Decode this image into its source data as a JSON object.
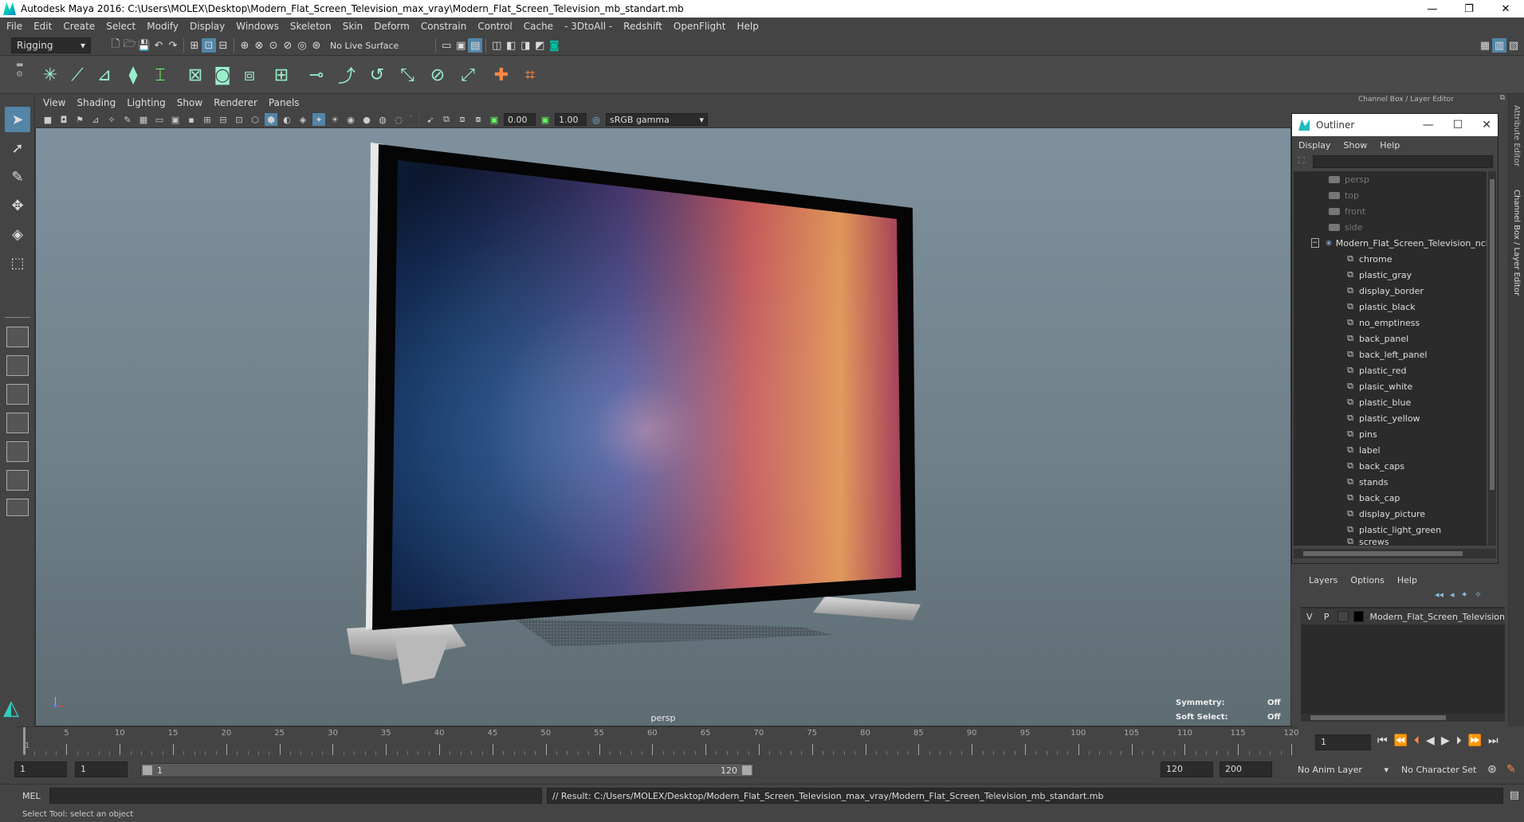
{
  "window": {
    "title": "Autodesk Maya 2016: C:\\Users\\MOLEX\\Desktop\\Modern_Flat_Screen_Television_max_vray\\Modern_Flat_Screen_Television_mb_standart.mb",
    "minimize": "—",
    "restore": "❐",
    "close": "✕"
  },
  "menubar": [
    "File",
    "Edit",
    "Create",
    "Select",
    "Modify",
    "Display",
    "Windows",
    "Skeleton",
    "Skin",
    "Deform",
    "Constrain",
    "Control",
    "Cache",
    "- 3DtoAll -",
    "Redshift",
    "OpenFlight",
    "Help"
  ],
  "statusline": {
    "menuset": "Rigging",
    "live_surface": "No Live Surface"
  },
  "viewport": {
    "menu": [
      "View",
      "Shading",
      "Lighting",
      "Show",
      "Renderer",
      "Panels"
    ],
    "exposure": "0.00",
    "gamma": "1.00",
    "color_space": "sRGB gamma",
    "camera": "persp",
    "symmetry_label": "Symmetry:",
    "symmetry_value": "Off",
    "soft_select_label": "Soft Select:",
    "soft_select_value": "Off"
  },
  "channel_box": {
    "header": "Channel Box / Layer Editor",
    "side_tab_1": "Attribute Editor",
    "side_tab_2": "Channel Box / Layer Editor"
  },
  "outliner": {
    "title": "Outliner",
    "menu": [
      "Display",
      "Show",
      "Help"
    ],
    "cameras": [
      "persp",
      "top",
      "front",
      "side"
    ],
    "root": "Modern_Flat_Screen_Television_ncl",
    "children": [
      "chrome",
      "plastic_gray",
      "display_border",
      "plastic_black",
      "no_emptiness",
      "back_panel",
      "back_left_panel",
      "plastic_red",
      "plasic_white",
      "plastic_blue",
      "plastic_yellow",
      "pins",
      "label",
      "back_caps",
      "stands",
      "back_cap",
      "display_picture",
      "plastic_light_green",
      "screws"
    ]
  },
  "layers": {
    "menu": [
      "Layers",
      "Options",
      "Help"
    ],
    "row": {
      "v": "V",
      "p": "P",
      "name": "Modern_Flat_Screen_Television"
    }
  },
  "timeline": {
    "ticks": [
      1,
      5,
      10,
      15,
      20,
      25,
      30,
      35,
      40,
      45,
      50,
      55,
      60,
      65,
      70,
      75,
      80,
      85,
      90,
      95,
      100,
      105,
      110,
      115,
      120
    ],
    "current_frame": "1",
    "range_start_outer": "1",
    "range_start_inner": "1",
    "range_slider_start": "1",
    "range_slider_end": "120",
    "range_end_inner": "120",
    "range_end_outer": "200",
    "anim_layer": "No Anim Layer",
    "character_set": "No Character Set"
  },
  "command_line": {
    "label": "MEL",
    "result": "// Result: C:/Users/MOLEX/Desktop/Modern_Flat_Screen_Television_max_vray/Modern_Flat_Screen_Television_mb_standart.mb",
    "help": "Select Tool: select an object"
  },
  "colors": {
    "bg": "#444444",
    "field": "#2b2b2b",
    "active_tool": "#5285a6",
    "accent": "#00c0a0"
  }
}
